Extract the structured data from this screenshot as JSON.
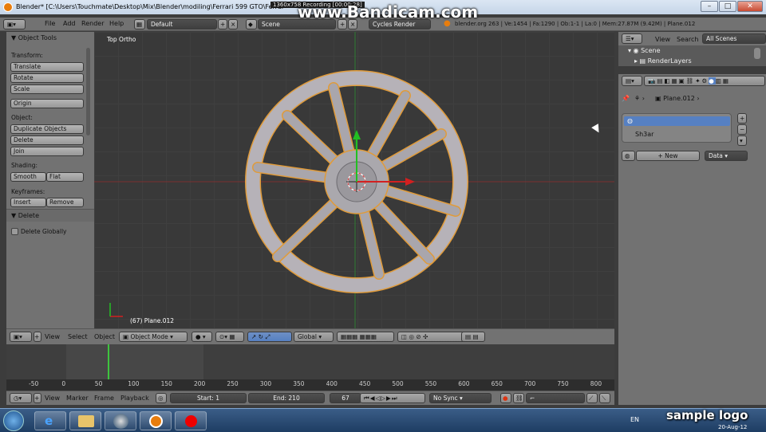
{
  "window": {
    "title": "Blender* [C:\\Users\\Touchmate\\Desktop\\Mix\\Blender\\modiling\\Ferrari 599 GTO\\Ferrar",
    "minimize": "–",
    "maximize": "□",
    "close": "✕"
  },
  "recorder": {
    "brand": "www.Bandicam.com",
    "status": "1360x758  Recording [00:00:28]"
  },
  "info": {
    "menus": [
      "File",
      "Add",
      "Render",
      "Help"
    ],
    "layout": "Default",
    "scene": "Scene",
    "engine": "Cycles Render",
    "stats": "blender.org 263 | Ve:1454 | Fa:1290 | Ob:1-1 | La:0 | Mem:27.87M (9.42M) | Plane.012"
  },
  "toolshelf": {
    "title": "Object Tools",
    "transform_label": "Transform:",
    "translate": "Translate",
    "rotate": "Rotate",
    "scale": "Scale",
    "origin": "Origin",
    "object_label": "Object:",
    "duplicate": "Duplicate Objects",
    "delete": "Delete",
    "join": "Join",
    "shading_label": "Shading:",
    "smooth": "Smooth",
    "flat": "Flat",
    "keyframes_label": "Keyframes:",
    "insert": "Insert",
    "remove": "Remove",
    "op_title": "Delete",
    "delete_globally": "Delete Globally"
  },
  "viewport": {
    "view_name": "Top Ortho",
    "object_info": "(67) Plane.012"
  },
  "v3dheader": {
    "view": "View",
    "select": "Select",
    "object": "Object",
    "mode": "Object Mode",
    "orientation": "Global"
  },
  "timeline": {
    "ticks": [
      "-50",
      "0",
      "50",
      "100",
      "150",
      "200",
      "250",
      "300",
      "350",
      "400",
      "450",
      "500",
      "550",
      "600",
      "650",
      "700",
      "750",
      "800"
    ],
    "current_frame_value": 67,
    "view": "View",
    "marker": "Marker",
    "frame": "Frame",
    "playback": "Playback",
    "start": "Start: 1",
    "end": "End: 210",
    "current": "67",
    "sync": "No Sync"
  },
  "outliner": {
    "view": "View",
    "search": "Search",
    "filter": "All Scenes",
    "scene": "Scene",
    "renderlayers": "RenderLayers"
  },
  "properties": {
    "object": "Plane.012",
    "material_slot": "",
    "material_name": "Sh3ar",
    "new_button": "New",
    "data_select": "Data"
  },
  "taskbar": {
    "lang": "EN",
    "date": "20-Aug-12"
  },
  "watermark": "sample logo",
  "colors": {
    "blender_orange": "#e87d0d",
    "selection_blue": "#5680c2",
    "keyframe_green": "#3ec43e"
  }
}
